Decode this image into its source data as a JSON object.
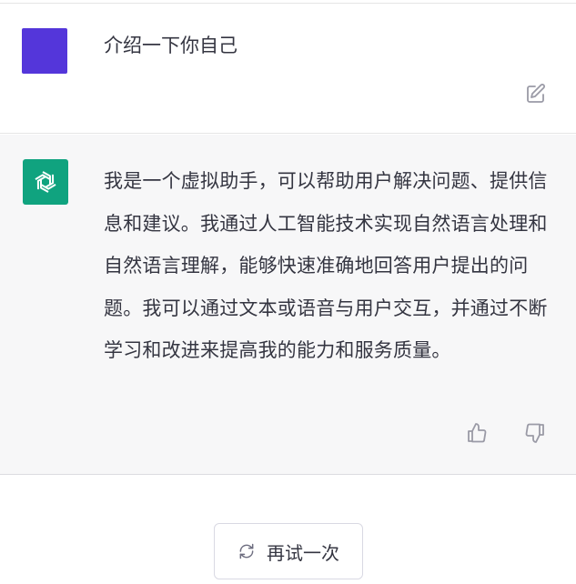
{
  "conversation": {
    "user_message": "介绍一下你自己",
    "assistant_message": "我是一个虚拟助手，可以帮助用户解决问题、提供信息和建议。我通过人工智能技术实现自然语言处理和自然语言理解，能够快速准确地回答用户提出的问题。我可以通过文本或语音与用户交互，并通过不断学习和改进来提高我的能力和服务质量。"
  },
  "actions": {
    "retry_label": "再试一次"
  },
  "colors": {
    "user_avatar": "#5436da",
    "assistant_avatar": "#10a37f",
    "assistant_bg": "#f7f7f8"
  },
  "icons": {
    "edit": "edit-icon",
    "thumbs_up": "thumbs-up-icon",
    "thumbs_down": "thumbs-down-icon",
    "retry": "refresh-icon",
    "assistant_logo": "openai-logo-icon"
  }
}
